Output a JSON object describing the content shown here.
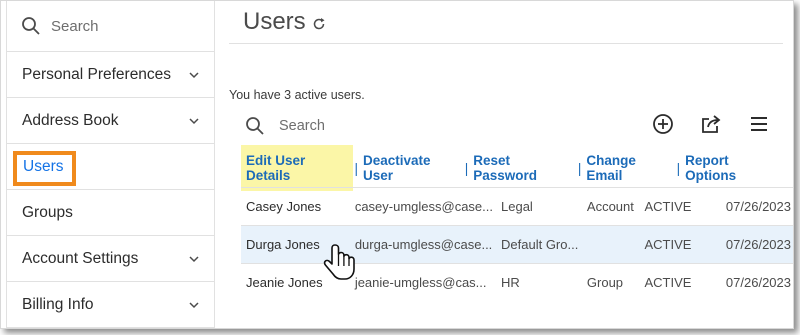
{
  "sidebar": {
    "search_placeholder": "Search",
    "items": [
      {
        "label": "Personal Preferences",
        "chevron": true
      },
      {
        "label": "Address Book",
        "chevron": true
      },
      {
        "label": "Users",
        "chevron": false,
        "active": true
      },
      {
        "label": "Groups",
        "chevron": false
      },
      {
        "label": "Account Settings",
        "chevron": true
      },
      {
        "label": "Billing Info",
        "chevron": true
      }
    ]
  },
  "main": {
    "title": "Users",
    "subtitle": "You have 3 active users.",
    "search_placeholder": "Search",
    "actions": [
      "Edit User Details",
      "Deactivate User",
      "Reset Password",
      "Change Email",
      "Report Options"
    ],
    "action_separator": "|",
    "users": [
      {
        "name": "Casey Jones",
        "email": "casey-umgless@case...",
        "group": "Legal",
        "type": "Account",
        "status": "ACTIVE",
        "date": "07/26/2023"
      },
      {
        "name": "Durga Jones",
        "email": "durga-umgless@case...",
        "group": "Default Gro...",
        "type": "",
        "status": "ACTIVE",
        "date": "07/26/2023",
        "selected": true
      },
      {
        "name": "Jeanie Jones",
        "email": "jeanie-umgless@cas...",
        "group": "HR",
        "type": "Group",
        "status": "ACTIVE",
        "date": "07/26/2023"
      }
    ]
  },
  "colors": {
    "accent": "#1473e6",
    "highlight": "#f08a1c",
    "action_link": "#1c6bb8",
    "selected_row": "#e8f2fb",
    "edit_highlight": "#fbf6a7"
  },
  "icons": [
    "search-icon",
    "chevron-down-icon",
    "refresh-icon",
    "add-circle-icon",
    "share-icon",
    "menu-icon",
    "hand-cursor-icon"
  ]
}
